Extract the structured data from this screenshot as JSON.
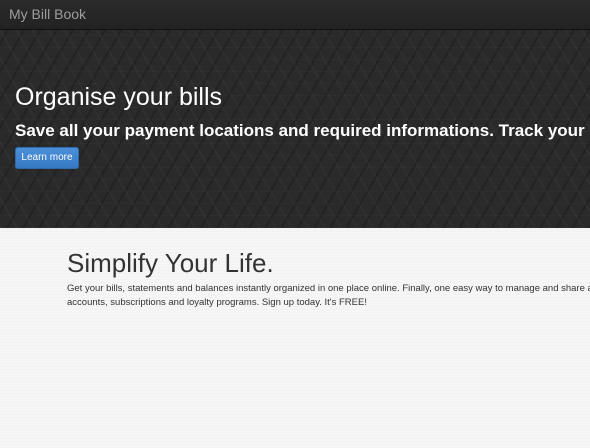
{
  "navbar": {
    "brand": "My Bill Book"
  },
  "hero": {
    "title": "Organise your bills",
    "subtitle": "Save all your payment locations and required informations. Track your payments.",
    "button_label": "Learn more"
  },
  "section": {
    "title": "Simplify Your Life.",
    "text_line1": "Get your bills, statements and balances instantly organized in one place online. Finally, one easy way to manage and share all of your",
    "text_line2": "accounts, subscriptions and loyalty programs. Sign up today. It's FREE!"
  },
  "colors": {
    "navbar_bg": "#222222",
    "hero_bg": "#2a2a2a",
    "button_bg": "#428bca",
    "content_bg": "#f6f6f6"
  }
}
